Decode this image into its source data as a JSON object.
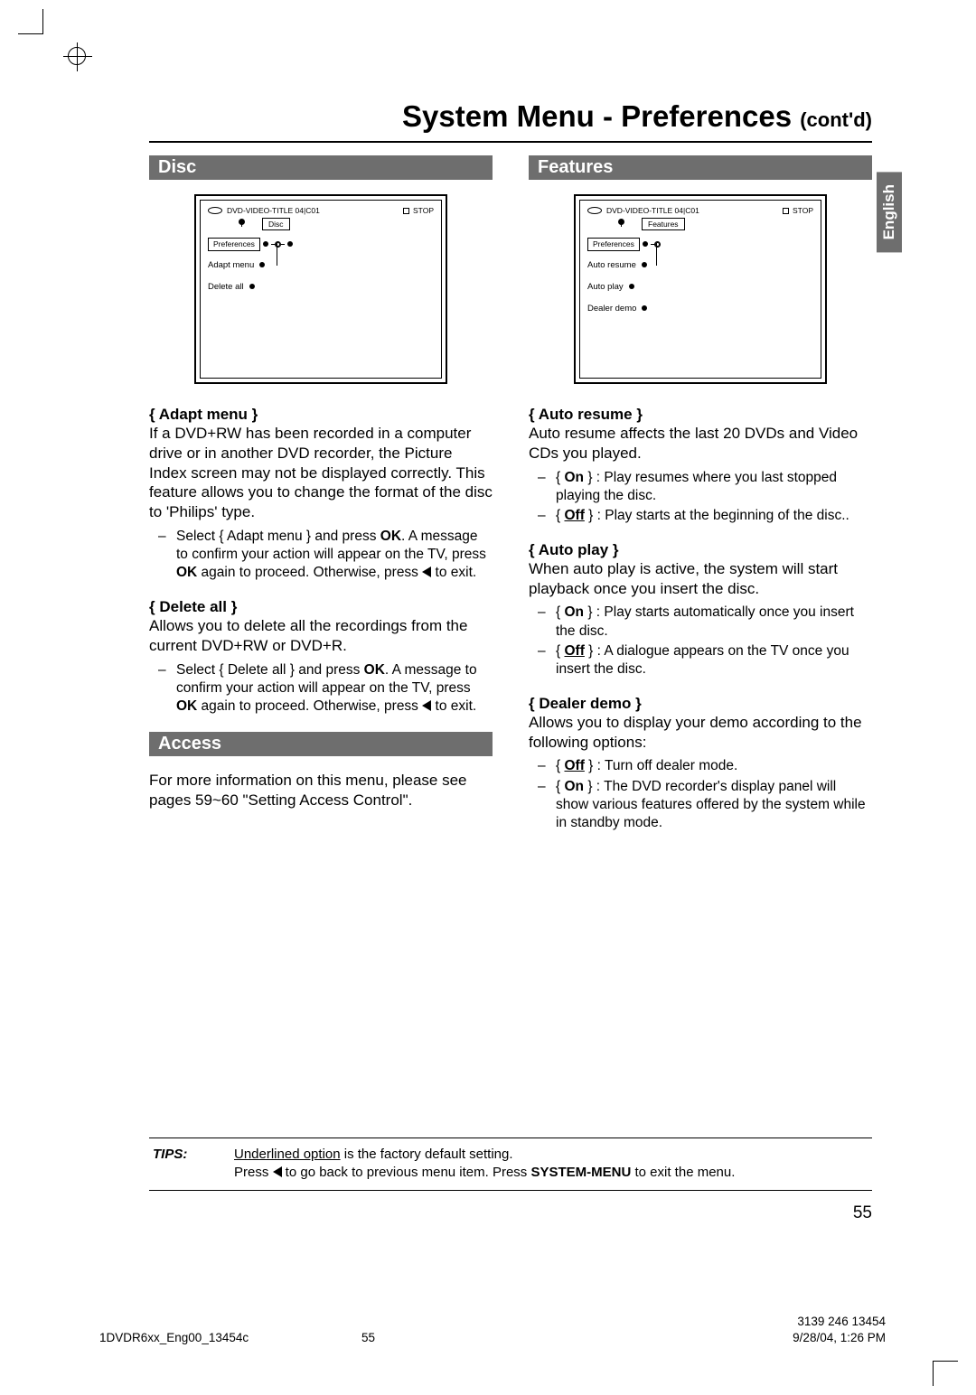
{
  "page": {
    "title_main": "System Menu - Preferences",
    "title_contd": "(cont'd)",
    "language_tab": "English",
    "page_number": "55"
  },
  "osd_common": {
    "title_line": "DVD-VIDEO-TITLE 04|C01",
    "stop": "STOP"
  },
  "disc": {
    "section": "Disc",
    "osd_tab": "Disc",
    "osd_root": "Preferences",
    "osd_items": [
      "Adapt menu",
      "Delete all"
    ],
    "adapt": {
      "head": "{ Adapt menu }",
      "body": "If a DVD+RW has been recorded in a computer drive or in another DVD recorder, the Picture Index screen may not be displayed correctly.  This feature allows you to change the format of the disc to 'Philips' type.",
      "bullet_pre": "Select { Adapt menu } and press ",
      "bullet_ok1": "OK",
      "bullet_mid": ". A message to confirm your action will appear on the TV, press ",
      "bullet_ok2": "OK",
      "bullet_post": " again to proceed. Otherwise, press ",
      "bullet_exit": " to exit."
    },
    "delete": {
      "head": "{ Delete all }",
      "body": "Allows you to delete all the recordings from the current DVD+RW or DVD+R.",
      "bullet_pre": "Select { Delete all } and press ",
      "bullet_ok1": "OK",
      "bullet_mid": ". A message to confirm your action will appear on the TV, press ",
      "bullet_ok2": "OK",
      "bullet_post": " again to proceed. Otherwise, press ",
      "bullet_exit": " to exit."
    }
  },
  "access": {
    "section": "Access",
    "body": "For more information on this menu, please see pages 59~60 \"Setting Access Control\"."
  },
  "features": {
    "section": "Features",
    "osd_tab": "Features",
    "osd_root": "Preferences",
    "osd_items": [
      "Auto resume",
      "Auto play",
      "Dealer demo"
    ],
    "auto_resume": {
      "head": "{ Auto resume }",
      "body": "Auto resume affects the last 20 DVDs and Video CDs you played.",
      "opt_on_label": "On",
      "opt_on_text": " } : Play resumes where you last stopped playing the disc.",
      "opt_off_label": "Off",
      "opt_off_text": " } : Play starts at the beginning of the disc.."
    },
    "auto_play": {
      "head": "{ Auto play }",
      "body": "When auto play is active, the system will start playback once you insert the disc.",
      "opt_on_label": "On",
      "opt_on_text": " } : Play starts automatically once you insert the disc.",
      "opt_off_label": "Off",
      "opt_off_text": " } : A dialogue appears on the TV once you insert the disc."
    },
    "dealer_demo": {
      "head": "{ Dealer demo }",
      "body": "Allows you to display your demo according to the following options:",
      "opt_off_label": "Off",
      "opt_off_text": " } : Turn off dealer mode.",
      "opt_on_label": "On",
      "opt_on_text": " } : The DVD recorder's display panel will show various features offered by the system while in standby mode."
    }
  },
  "tips": {
    "label": "TIPS:",
    "line1_pre": "",
    "line1_underline": "Underlined option",
    "line1_post": " is the factory default setting.",
    "line2_pre": "Press ",
    "line2_mid": " to go back to previous menu item.  Press ",
    "line2_bold": "SYSTEM-MENU",
    "line2_post": " to exit the menu."
  },
  "footer": {
    "left": "1DVDR6xx_Eng00_13454c",
    "mid": "55",
    "right": "9/28/04, 1:26 PM",
    "part": "3139 246 13454"
  }
}
